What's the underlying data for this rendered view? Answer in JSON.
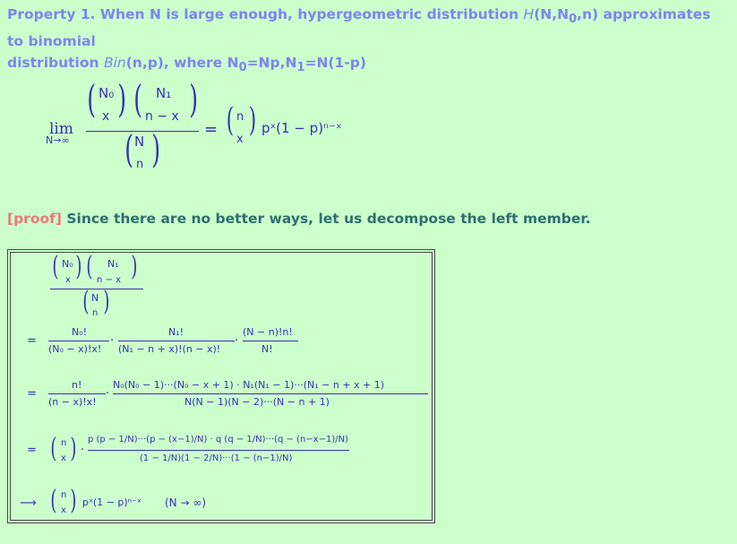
{
  "heading": {
    "prefix": "Property 1. When N is large enough, hypergeometric distribution ",
    "hyper_sym": "H",
    "hyper_args": "(N,N",
    "hyper_sub": "0",
    "hyper_tail": ",n) approximates to binomial",
    "line2_a": "distribution ",
    "bin_sym": "Bin",
    "bin_args": "(n,p), where N",
    "n0_sub": "0",
    "mid": "=Np,N",
    "n1_sub": "1",
    "tail": "=N(1-p)"
  },
  "main_formula": {
    "lim": "lim",
    "lim_sub": "N→∞",
    "top_left_top": "N₀",
    "top_left_bottom": "x",
    "top_right_top": "N₁",
    "top_right_bottom": "n − x",
    "bottom_top": "N",
    "bottom_bottom": "n",
    "equals": "=",
    "rhs_top": "n",
    "rhs_bottom": "x",
    "rhs_tail": "pˣ(1 − p)ⁿ⁻ˣ"
  },
  "proof": {
    "tag": "[proof]",
    "text": " Since there are no better ways, let us decompose the left member."
  },
  "derivation": {
    "l0_a_top": "N₀",
    "l0_a_bot": "x",
    "l0_b_top": "N₁",
    "l0_b_bot": "n − x",
    "l0_c_top": "N",
    "l0_c_bot": "n",
    "eq": "=",
    "l1_f1_num": "N₀!",
    "l1_f1_den": "(N₀ − x)!x!",
    "dot": "·",
    "l1_f2_num": "N₁!",
    "l1_f2_den": "(N₁ − n + x)!(n − x)!",
    "l1_f3_num": "(N − n)!n!",
    "l1_f3_den": "N!",
    "l2_f1_num": "n!",
    "l2_f1_den": "(n − x)!x!",
    "l2_f2_num": "N₀(N₀ − 1)···(N₀ − x + 1) · N₁(N₁ − 1)···(N₁ − n + x + 1)",
    "l2_f2_den": "N(N − 1)(N − 2)···(N − n + 1)",
    "l3_binom_top": "n",
    "l3_binom_bot": "x",
    "l3_num": "p (p − 1/N)···(p − (x−1)/N) · q (q − 1/N)···(q − (n−x−1)/N)",
    "l3_den": "(1 − 1/N)(1 − 2/N)···(1 − (n−1)/N)",
    "arrow": "⟶",
    "l4_binom_top": "n",
    "l4_binom_bot": "x",
    "l4_tail": "pˣ(1 − p)ⁿ⁻ˣ",
    "l4_cond": "(N → ∞)"
  }
}
